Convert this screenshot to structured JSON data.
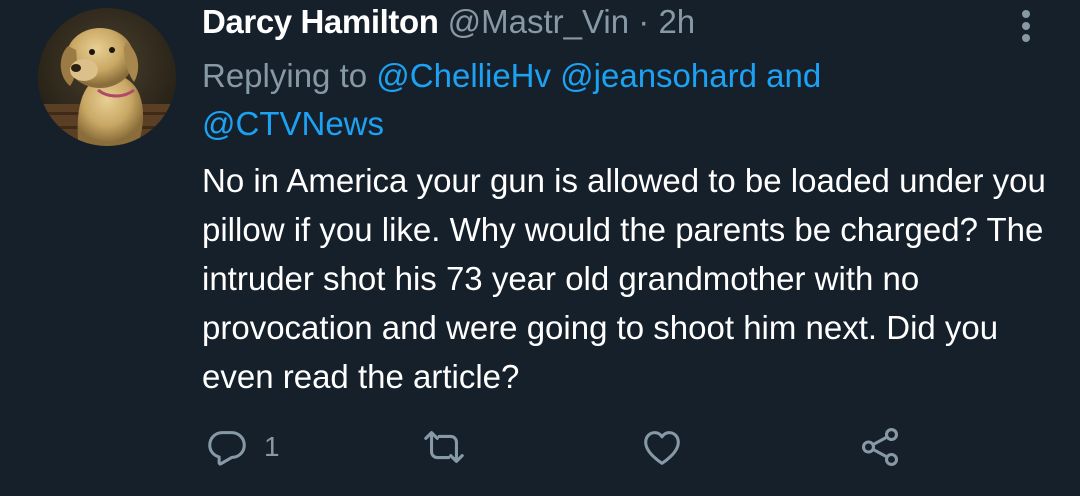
{
  "tweet": {
    "display_name": "Darcy Hamilton",
    "handle": "@Mastr_Vin",
    "separator": "·",
    "time": "2h",
    "replying_prefix": "Replying to",
    "mentions": [
      "@ChellieHv",
      "@jeansohard",
      "@CTVNews"
    ],
    "and_word": "and",
    "text": "No in America your gun is allowed to be loaded under you pillow if you like. Why would the parents be charged? The intruder shot his 73 year old grandmother with no provocation and were going to shoot him next. Did you even read the article?",
    "reply_count": "1",
    "avatar_icon": "dog-photo-avatar",
    "more_icon": "vertical-ellipsis-icon",
    "action_icons": [
      "reply-icon",
      "retweet-icon",
      "like-icon",
      "share-icon"
    ]
  },
  "colors": {
    "background": "#15202b",
    "text": "#ffffff",
    "secondary": "#8899a6",
    "link": "#1da1f2"
  }
}
